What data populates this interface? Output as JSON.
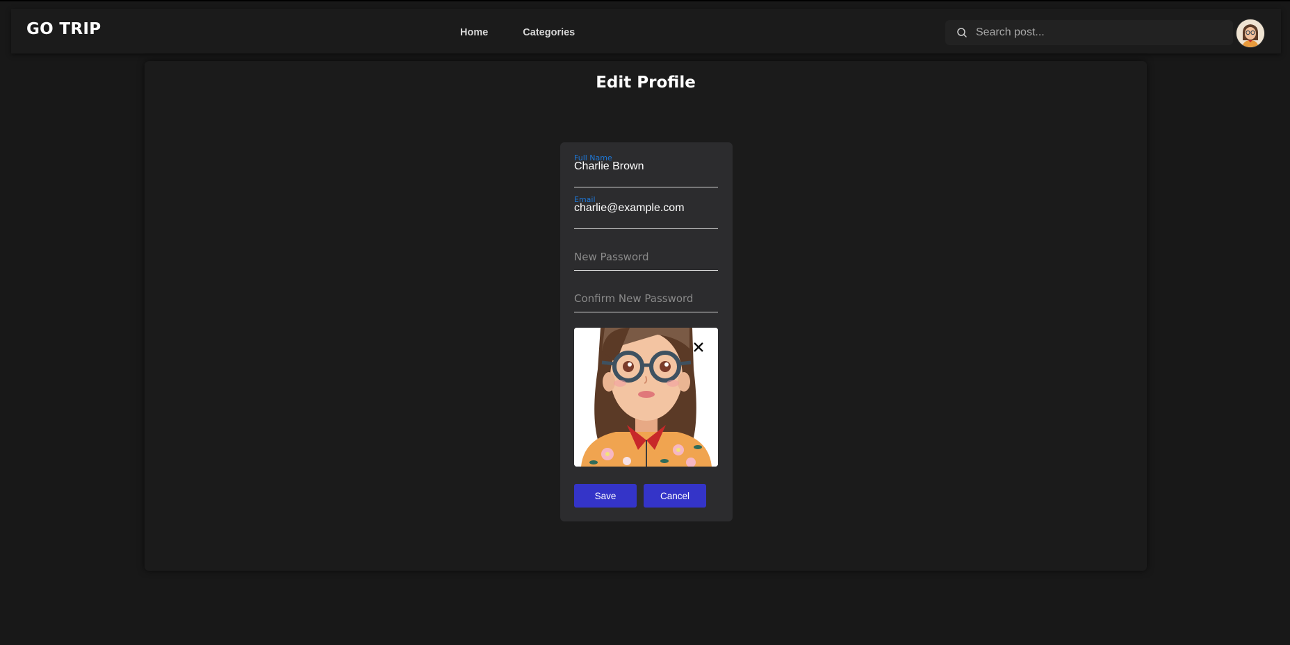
{
  "app": {
    "logo": "GO TRIP"
  },
  "nav": {
    "items": [
      {
        "label": "Home"
      },
      {
        "label": "Categories"
      }
    ]
  },
  "search": {
    "placeholder": "Search post...",
    "icon": "search-icon"
  },
  "user": {
    "avatar_icon": "user-avatar"
  },
  "page": {
    "title": "Edit Profile"
  },
  "form": {
    "full_name": {
      "label": "Full Name",
      "value": "Charlie Brown"
    },
    "email": {
      "label": "Email",
      "value": "charlie@example.com"
    },
    "new_password": {
      "placeholder": "New Password"
    },
    "confirm_password": {
      "placeholder": "Confirm New Password"
    },
    "image": {
      "remove_icon": "close-icon"
    },
    "save_label": "Save",
    "cancel_label": "Cancel"
  },
  "colors": {
    "background": "#181818",
    "card": "#1b1b1b",
    "form_card": "#2c2c2e",
    "accent_label": "#1e77d6",
    "button": "#3434c8"
  }
}
